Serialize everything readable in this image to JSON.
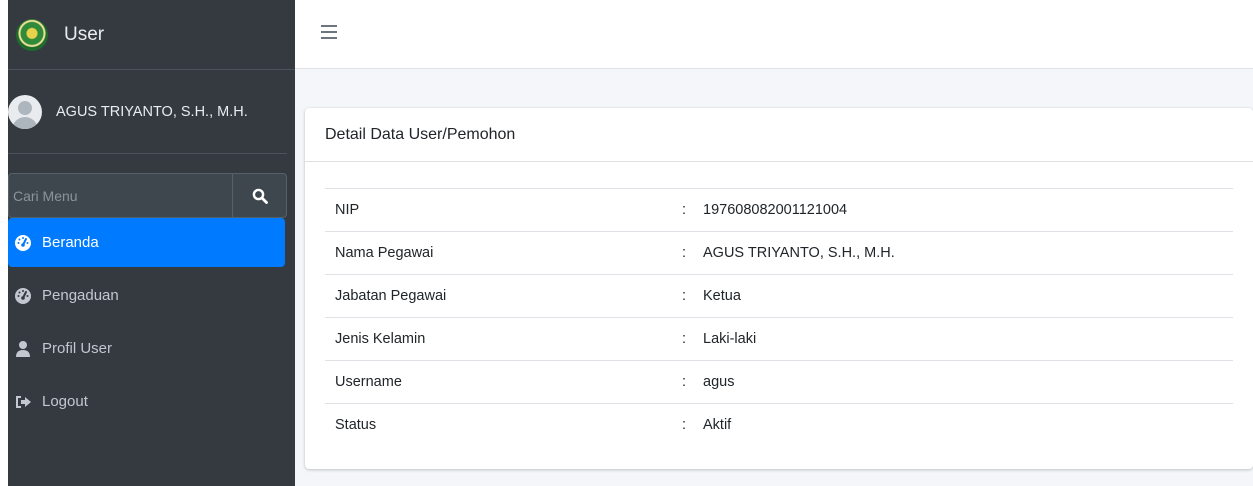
{
  "brand": {
    "title": "User",
    "logo_icon": "court-emblem-icon"
  },
  "user_panel": {
    "name": "AGUS TRIYANTO, S.H., M.H.",
    "avatar_icon": "user-avatar-icon"
  },
  "search": {
    "placeholder": "Cari Menu",
    "icon": "search-icon"
  },
  "sidebar": {
    "items": [
      {
        "label": "Beranda",
        "icon": "tachometer-icon",
        "active": true
      },
      {
        "label": "Pengaduan",
        "icon": "tachometer-icon",
        "active": false
      },
      {
        "label": "Profil User",
        "icon": "user-icon",
        "active": false
      },
      {
        "label": "Logout",
        "icon": "sign-out-icon",
        "active": false
      }
    ]
  },
  "topbar": {
    "menu_icon": "hamburger-icon"
  },
  "card": {
    "title": "Detail Data User/Pemohon",
    "separator": ":",
    "rows": [
      {
        "label": "NIP",
        "value": "197608082001121004"
      },
      {
        "label": "Nama Pegawai",
        "value": "AGUS TRIYANTO, S.H., M.H."
      },
      {
        "label": "Jabatan Pegawai",
        "value": "Ketua"
      },
      {
        "label": "Jenis Kelamin",
        "value": "Laki-laki"
      },
      {
        "label": "Username",
        "value": "agus"
      },
      {
        "label": "Status",
        "value": "Aktif"
      }
    ]
  },
  "colors": {
    "sidebar_bg": "#343a40",
    "active_item": "#007bff",
    "content_bg": "#f4f6f9"
  }
}
